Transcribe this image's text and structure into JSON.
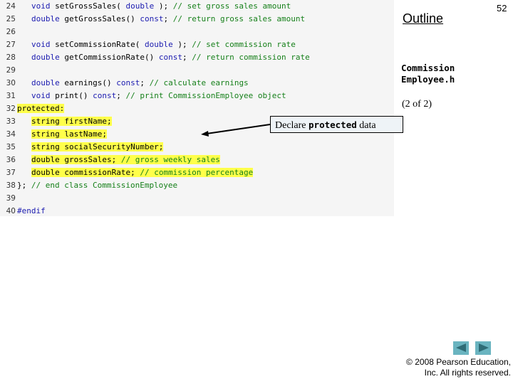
{
  "code": {
    "lines": [
      {
        "num": "24",
        "indent": true,
        "parts": [
          {
            "t": "void",
            "c": "kw"
          },
          {
            "t": " setGrossSales( "
          },
          {
            "t": "double",
            "c": "kw"
          },
          {
            "t": " ); "
          },
          {
            "t": "// set gross sales amount",
            "c": "cm"
          }
        ]
      },
      {
        "num": "25",
        "indent": true,
        "parts": [
          {
            "t": "double",
            "c": "kw"
          },
          {
            "t": " getGrossSales() "
          },
          {
            "t": "const",
            "c": "kw"
          },
          {
            "t": "; "
          },
          {
            "t": "// return gross sales amount",
            "c": "cm"
          }
        ]
      },
      {
        "num": "26",
        "indent": false,
        "parts": []
      },
      {
        "num": "27",
        "indent": true,
        "parts": [
          {
            "t": "void",
            "c": "kw"
          },
          {
            "t": " setCommissionRate( "
          },
          {
            "t": "double",
            "c": "kw"
          },
          {
            "t": " ); "
          },
          {
            "t": "// set commission rate",
            "c": "cm"
          }
        ]
      },
      {
        "num": "28",
        "indent": true,
        "parts": [
          {
            "t": "double",
            "c": "kw"
          },
          {
            "t": " getCommissionRate() "
          },
          {
            "t": "const",
            "c": "kw"
          },
          {
            "t": "; "
          },
          {
            "t": "// return commission rate",
            "c": "cm"
          }
        ]
      },
      {
        "num": "29",
        "indent": false,
        "parts": []
      },
      {
        "num": "30",
        "indent": true,
        "parts": [
          {
            "t": "double",
            "c": "kw"
          },
          {
            "t": " earnings() "
          },
          {
            "t": "const",
            "c": "kw"
          },
          {
            "t": "; "
          },
          {
            "t": "// calculate earnings",
            "c": "cm"
          }
        ]
      },
      {
        "num": "31",
        "indent": true,
        "parts": [
          {
            "t": "void",
            "c": "kw"
          },
          {
            "t": " print() "
          },
          {
            "t": "const",
            "c": "kw"
          },
          {
            "t": "; "
          },
          {
            "t": "// print CommissionEmployee object",
            "c": "cm"
          }
        ]
      },
      {
        "num": "32",
        "indent": false,
        "highlight": true,
        "parts": [
          {
            "t": "protected:"
          }
        ]
      },
      {
        "num": "33",
        "indent": true,
        "highlight": true,
        "parts": [
          {
            "t": "string firstName;"
          }
        ]
      },
      {
        "num": "34",
        "indent": true,
        "highlight": true,
        "parts": [
          {
            "t": "string lastName;"
          }
        ]
      },
      {
        "num": "35",
        "indent": true,
        "highlight": true,
        "parts": [
          {
            "t": "string socialSecurityNumber;"
          }
        ]
      },
      {
        "num": "36",
        "indent": true,
        "highlight": true,
        "parts": [
          {
            "t": "double grossSales; "
          },
          {
            "t": "// gross weekly sales",
            "c": "cm"
          }
        ]
      },
      {
        "num": "37",
        "indent": true,
        "highlight": true,
        "parts": [
          {
            "t": "double commissionRate; "
          },
          {
            "t": "// commission percentage",
            "c": "cm"
          }
        ]
      },
      {
        "num": "38",
        "indent": false,
        "parts": [
          {
            "t": "}; "
          },
          {
            "t": "// end class CommissionEmployee",
            "c": "cm"
          }
        ]
      },
      {
        "num": "39",
        "indent": false,
        "parts": []
      },
      {
        "num": "40",
        "indent": false,
        "parts": [
          {
            "t": "#endif",
            "c": "kw"
          }
        ]
      }
    ]
  },
  "sidebar": {
    "outline_label": "Outline",
    "page_number": "52",
    "filename_line1": "Commission",
    "filename_line2": "Employee.h",
    "part_label": "(2 of 2)"
  },
  "callout": {
    "prefix": "Declare ",
    "keyword": "protected",
    "suffix": " data"
  },
  "navigation": {
    "prev_icon": "triangle-left",
    "next_icon": "triangle-right"
  },
  "footer": {
    "copyright_line1": "© 2008 Pearson Education,",
    "copyright_line2": "Inc.  All rights reserved."
  },
  "colors": {
    "keyword": "#1b1bb0",
    "comment": "#16801a",
    "highlight": "#ffff4a",
    "nav_button": "#6ab4c0",
    "nav_arrow": "#2f6c76"
  }
}
